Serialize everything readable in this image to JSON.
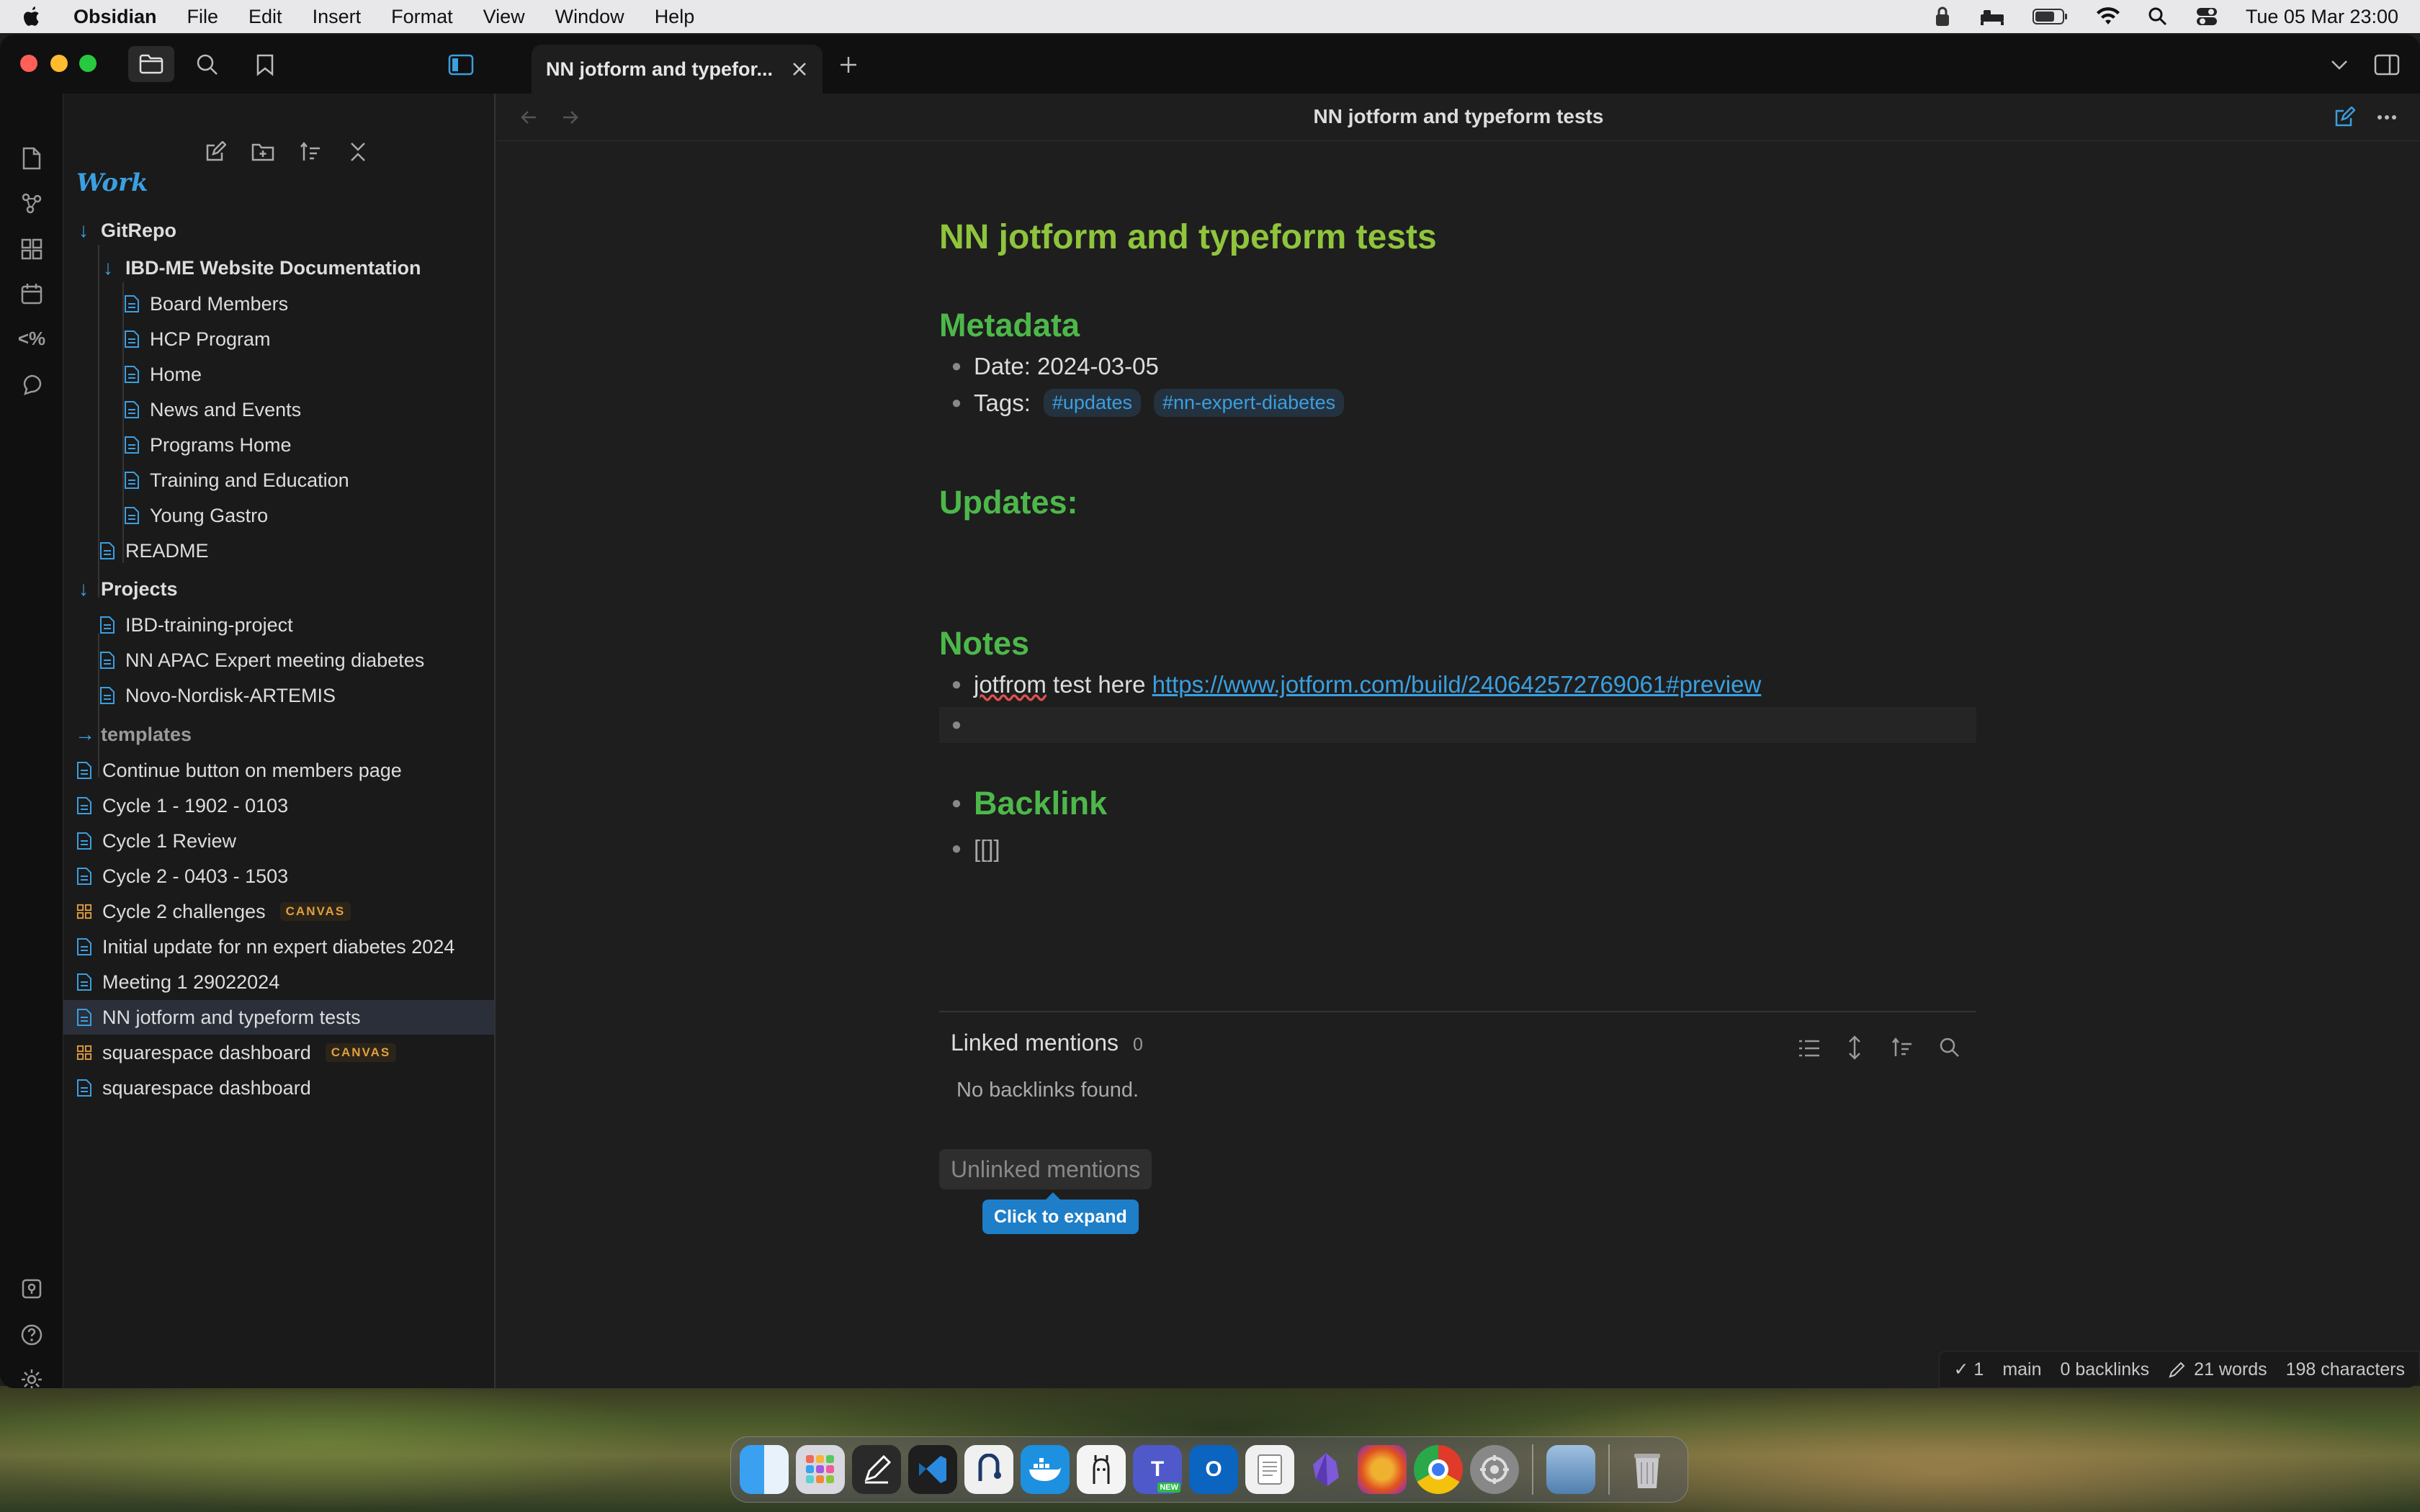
{
  "menubar": {
    "app": "Obsidian",
    "items": [
      "File",
      "Edit",
      "Insert",
      "Format",
      "View",
      "Window",
      "Help"
    ],
    "clock": "Tue 05 Mar  23:00"
  },
  "tab": {
    "title": "NN jotform and typefor..."
  },
  "view": {
    "title": "NN jotform and typeform tests"
  },
  "sidebar": {
    "vault": "Work",
    "tree": [
      {
        "label": "GitRepo",
        "type": "folder"
      },
      {
        "label": "IBD-ME Website Documentation",
        "type": "folder"
      },
      {
        "label": "Board Members",
        "type": "file"
      },
      {
        "label": "HCP Program",
        "type": "file"
      },
      {
        "label": "Home",
        "type": "file"
      },
      {
        "label": "News and Events",
        "type": "file"
      },
      {
        "label": "Programs Home",
        "type": "file"
      },
      {
        "label": "Training and Education",
        "type": "file"
      },
      {
        "label": "Young Gastro",
        "type": "file"
      },
      {
        "label": "README",
        "type": "file"
      },
      {
        "label": "Projects",
        "type": "folder"
      },
      {
        "label": "IBD-training-project",
        "type": "file"
      },
      {
        "label": "NN APAC Expert meeting diabetes",
        "type": "file"
      },
      {
        "label": "Novo-Nordisk-ARTEMIS",
        "type": "file"
      },
      {
        "label": "templates",
        "type": "folder-collapsed"
      },
      {
        "label": "Continue button on members page",
        "type": "file"
      },
      {
        "label": "Cycle 1 - 1902 - 0103",
        "type": "file"
      },
      {
        "label": "Cycle 1 Review",
        "type": "file"
      },
      {
        "label": "Cycle 2 - 0403 - 1503",
        "type": "file"
      },
      {
        "label": "Cycle 2 challenges",
        "type": "canvas",
        "badge": "CANVAS"
      },
      {
        "label": "Initial update for nn expert diabetes 2024",
        "type": "file"
      },
      {
        "label": "Meeting 1 29022024",
        "type": "file"
      },
      {
        "label": "NN jotform and typeform tests",
        "type": "file",
        "active": true
      },
      {
        "label": "squarespace dashboard",
        "type": "canvas",
        "badge": "CANVAS"
      },
      {
        "label": "squarespace dashboard",
        "type": "file"
      }
    ]
  },
  "doc": {
    "title": "NN jotform and typeform tests",
    "metadata_heading": "Metadata",
    "date": "Date: 2024-03-05",
    "tags_label": "Tags:",
    "tags": [
      "#updates",
      "#nn-expert-diabetes"
    ],
    "updates_heading": "Updates:",
    "notes_heading": "Notes",
    "note_word1": "jotfrom",
    "note_text": " test here ",
    "note_link": "https://www.jotform.com/build/240642572769061#preview",
    "backlink_heading": "Backlink",
    "backlink_text": "[[]]"
  },
  "backlinks": {
    "linked_label": "Linked mentions",
    "linked_count": "0",
    "none_text": "No backlinks found.",
    "unlinked_label": "Unlinked mentions",
    "tooltip": "Click to expand"
  },
  "status": {
    "sync": "1",
    "branch": "main",
    "backlinks": "0 backlinks",
    "words": "21 words",
    "chars": "198 characters"
  }
}
